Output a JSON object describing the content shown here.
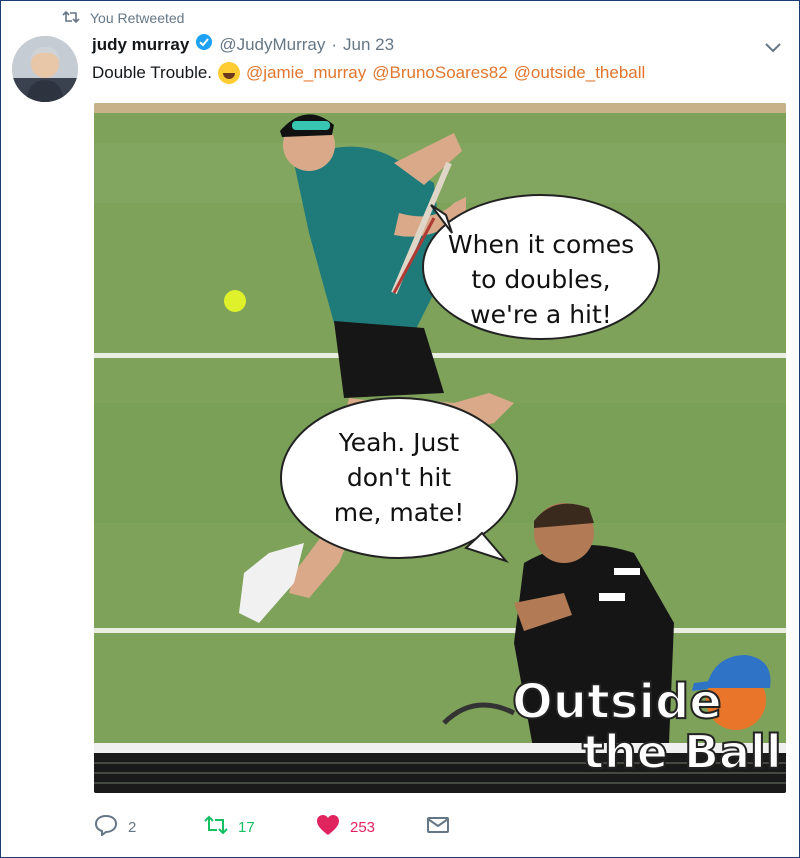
{
  "retweet_banner": "You Retweeted",
  "author": {
    "name": "judy murray",
    "handle": "@JudyMurray",
    "separator": "·",
    "date": "Jun 23"
  },
  "tweet": {
    "text": "Double Trouble.",
    "emoji": "rolling-on-floor-laughing-emoji",
    "mentions": [
      "@jamie_murray",
      "@BrunoSoares82",
      "@outside_theball"
    ]
  },
  "media": {
    "bubble_top": [
      "When it comes",
      "to doubles,",
      "we're a hit!"
    ],
    "bubble_bottom": [
      "Yeah. Just",
      "don't hit",
      "me, mate!"
    ],
    "logo_line1": "Outside",
    "logo_line2": "the Ball"
  },
  "actions": {
    "replies": "2",
    "retweets": "17",
    "likes": "253"
  },
  "colors": {
    "mention": "#e0762f",
    "retweet_active": "#17bf63",
    "like_active": "#e0245e",
    "verified": "#1da1f2",
    "court": "#7ea25a"
  },
  "icons": [
    "retweet-icon",
    "verified-icon",
    "chevron-down-icon",
    "reply-icon",
    "heart-icon",
    "envelope-icon"
  ]
}
